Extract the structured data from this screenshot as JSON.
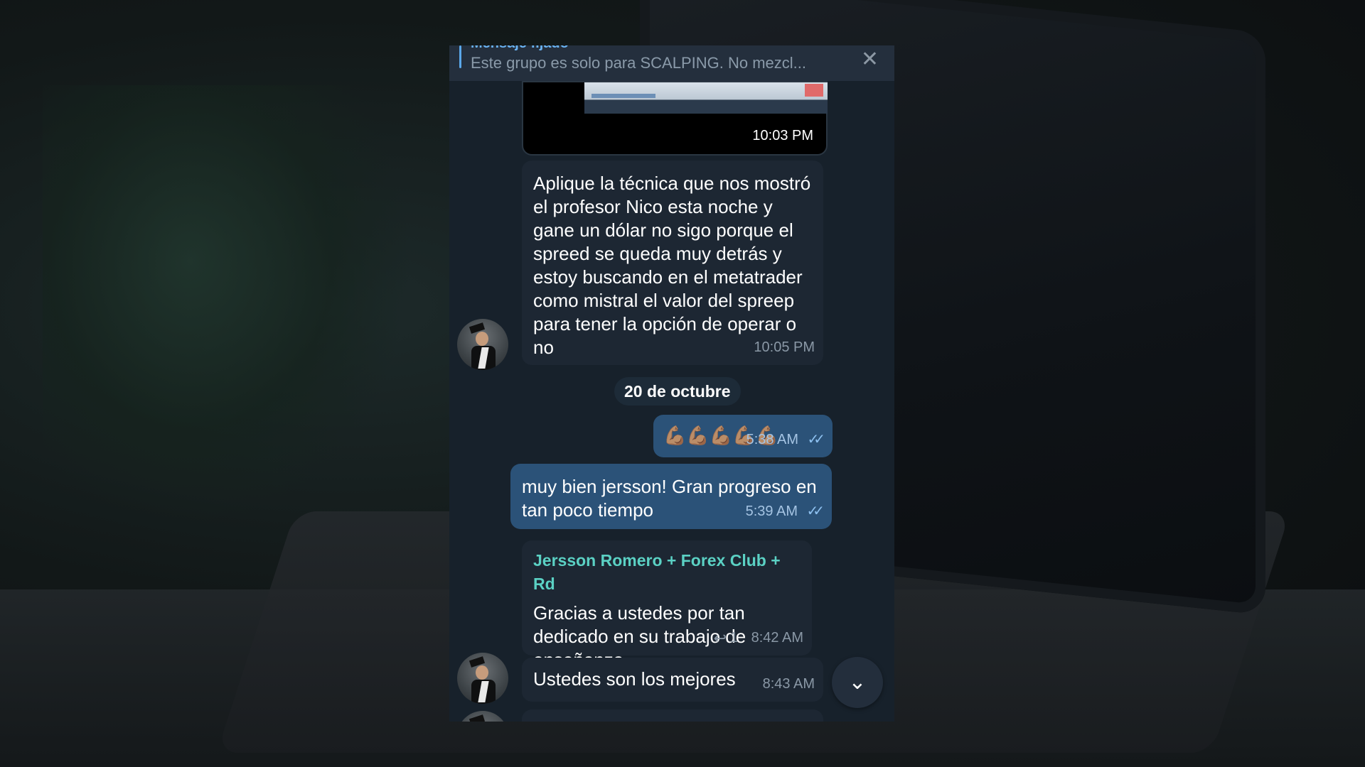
{
  "pinned": {
    "title": "Mensaje fijado",
    "text": "Este grupo es solo para SCALPING.  No mezcl...",
    "close_icon": "✕"
  },
  "messages": [
    {
      "type": "video",
      "time": "10:03 PM"
    },
    {
      "type": "text",
      "direction": "in",
      "text": "Aplique la técnica que nos mostró el profesor Nico esta noche y gane un dólar no sigo porque el spreed se queda muy detrás y estoy buscando en el metatrader como mistral el valor del spreep para tener la opción de operar o no",
      "time": "10:05 PM"
    },
    {
      "type": "date",
      "text": "20 de octubre"
    },
    {
      "type": "text",
      "direction": "out",
      "text": "💪🏽💪🏽💪🏽💪🏽💪🏽",
      "time": "5:38 AM"
    },
    {
      "type": "text",
      "direction": "out",
      "text": "muy bien jersson! Gran progreso en tan poco tiempo",
      "time": "5:39 AM"
    },
    {
      "type": "text",
      "direction": "in",
      "sender": "Jersson Romero + Forex Club + Rd",
      "text": "Gracias a ustedes por tan dedicado en su trabajo de enseñanza",
      "replies": "1",
      "time": "8:42 AM"
    },
    {
      "type": "text",
      "direction": "in",
      "text": "Ustedes son los mejores",
      "time": "8:43 AM"
    }
  ],
  "colors": {
    "chat_bg": "#17212b",
    "incoming_bubble": "#1d2733",
    "outgoing_bubble": "#2b5278",
    "sender_name": "#5bd1c4",
    "accent": "#5aa7e9"
  },
  "icons": {
    "scroll_down": "chevron-down-icon",
    "read_receipt": "double-check-icon",
    "reply": "reply-arrow-icon"
  }
}
